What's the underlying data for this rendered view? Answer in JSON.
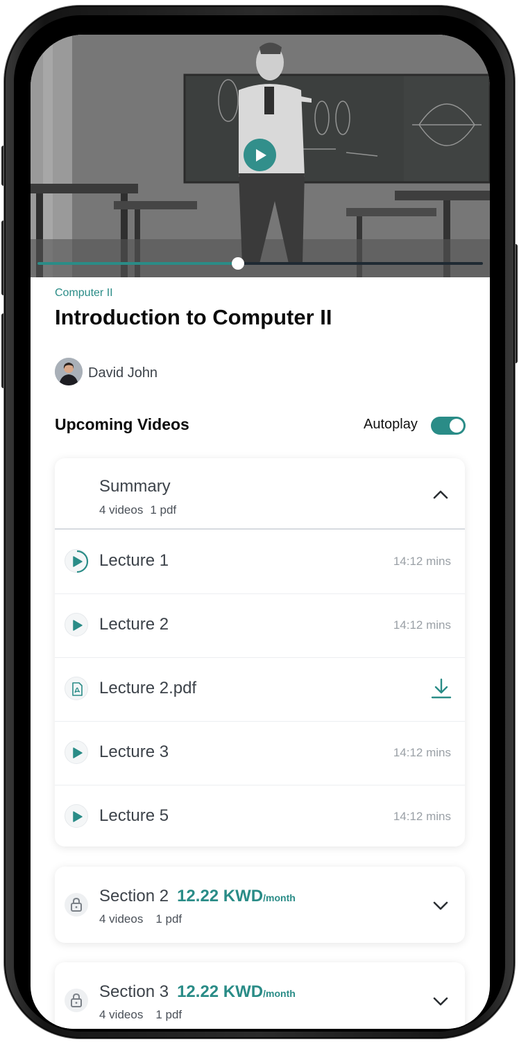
{
  "colors": {
    "accent": "#2a8c87",
    "title": "#0c0c0c",
    "text": "#3d434a",
    "muted": "#9aa0a6"
  },
  "video": {
    "progress_percent": 45,
    "play_icon": "play-icon"
  },
  "course": {
    "category": "Computer II",
    "title": "Introduction to Computer II",
    "author": "David John"
  },
  "upcoming": {
    "heading": "Upcoming Videos",
    "autoplay_label": "Autoplay",
    "autoplay_on": true
  },
  "summary": {
    "title": "Summary",
    "videos": "4 videos",
    "pdfs": "1 pdf",
    "expanded": true,
    "items": [
      {
        "type": "video",
        "title": "Lecture 1",
        "duration": "14:12 mins",
        "icon": "play-progress-icon"
      },
      {
        "type": "video",
        "title": "Lecture 2",
        "duration": "14:12 mins",
        "icon": "play-icon"
      },
      {
        "type": "pdf",
        "title": "Lecture 2.pdf",
        "icon": "pdf-icon",
        "action_icon": "download-icon"
      },
      {
        "type": "video",
        "title": "Lecture 3",
        "duration": "14:12 mins",
        "icon": "play-icon"
      },
      {
        "type": "video",
        "title": "Lecture 5",
        "duration": "14:12 mins",
        "icon": "play-icon"
      }
    ]
  },
  "sections": [
    {
      "title": "Section 2",
      "price": "12.22 KWD",
      "unit": "/month",
      "videos": "4 videos",
      "pdfs": "1 pdf",
      "icon": "lock-icon"
    },
    {
      "title": "Section 3",
      "price": "12.22 KWD",
      "unit": "/month",
      "videos": "4 videos",
      "pdfs": "1 pdf",
      "icon": "lock-icon"
    }
  ]
}
